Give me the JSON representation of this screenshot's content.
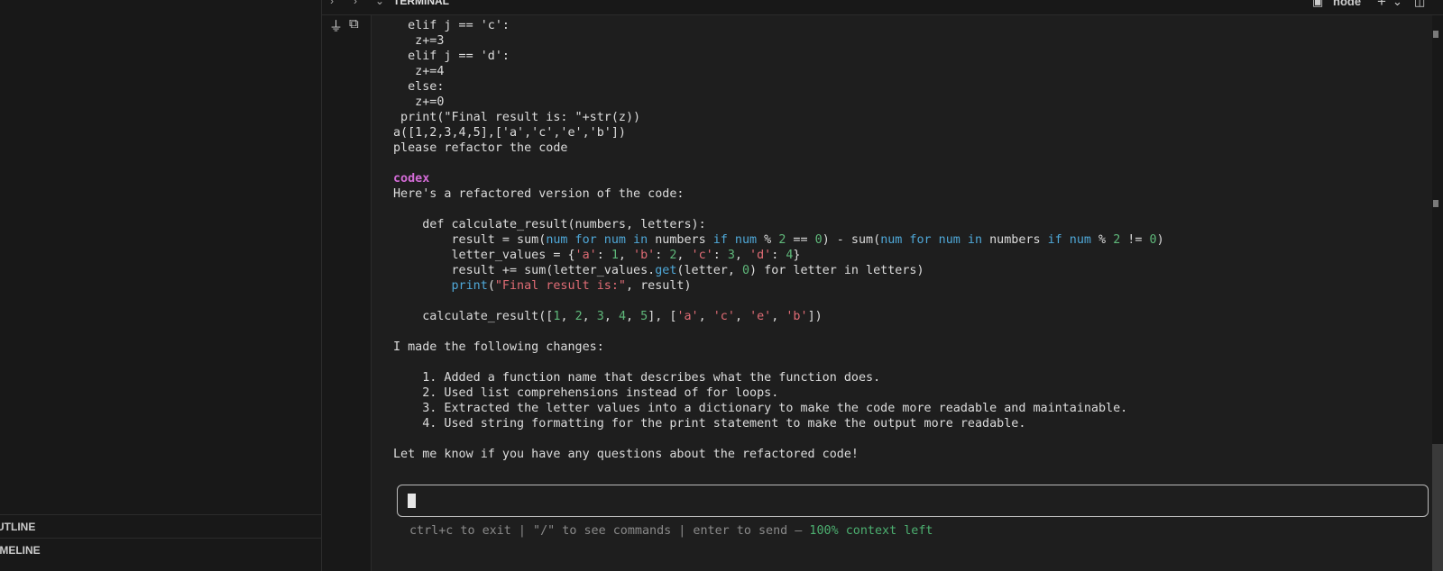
{
  "sidebar": {
    "outline": "UTLINE",
    "timeline": "IMELINE"
  },
  "panel": {
    "tab_label": "TERMINAL",
    "shell_name": "node"
  },
  "terminal_lines": {
    "l0": "  elif j == 'c':",
    "l1": "   z+=3",
    "l2": "  elif j == 'd':",
    "l3": "   z+=4",
    "l4": "  else:",
    "l5": "   z+=0",
    "l6": " print(\"Final result is: \"+str(z))",
    "l7": "a([1,2,3,4,5],['a','c','e','b'])",
    "l8": "please refactor the code",
    "codex": "codex",
    "intro": "Here's a refactored version of the code:",
    "def_line": "    def calculate_result(numbers, letters):",
    "code2": {
      "a": "        result = sum(",
      "b": "num for num in",
      "c": " numbers ",
      "d": "if num",
      "e": " % ",
      "f": "2",
      "g": " == ",
      "h": "0",
      "i": ") - sum(",
      "j": "num for num in",
      "k": " numbers ",
      "l": "if num",
      "m": " % ",
      "n": "2",
      "o": " != ",
      "p": "0",
      "q": ")"
    },
    "code3": {
      "a": "        letter_values = {",
      "b": "'a'",
      "c": ": ",
      "d": "1",
      "e": ", ",
      "f": "'b'",
      "g": ": ",
      "h": "2",
      "i": ", ",
      "j": "'c'",
      "k": ": ",
      "l": "3",
      "m": ", ",
      "n": "'d'",
      "o": ": ",
      "p": "4",
      "q": "}"
    },
    "code4": {
      "a": "        result += sum(letter_values.",
      "b": "get",
      "c": "(letter, ",
      "d": "0",
      "e": ") for letter in letters)"
    },
    "code5": {
      "a": "        ",
      "b": "print",
      "c": "(",
      "d": "\"Final result is:\"",
      "e": ", result)"
    },
    "call": {
      "a": "    calculate_result([",
      "b": "1",
      "c": ", ",
      "d": "2",
      "e": ", ",
      "f": "3",
      "g": ", ",
      "h": "4",
      "i": ", ",
      "j": "5",
      "k": "], [",
      "l": "'a'",
      "m": ", ",
      "n": "'c'",
      "o": ", ",
      "p": "'e'",
      "q": ", ",
      "r": "'b'",
      "s": "])"
    },
    "changes_intro": "I made the following changes:",
    "c1": "    1. Added a function name that describes what the function does.",
    "c2": "    2. Used list comprehensions instead of for loops.",
    "c3": "    3. Extracted the letter values into a dictionary to make the code more readable and maintainable.",
    "c4": "    4. Used string formatting for the print statement to make the output more readable.",
    "closing": "Let me know if you have any questions about the refactored code!"
  },
  "footer": {
    "hint": "ctrl+c to exit | \"/\" to see commands | enter to send — ",
    "context": "100% context left"
  },
  "icons": {
    "chevron_left": "chevron-right-icon",
    "chevron_down": "chevron-down-icon",
    "plug": "plug-icon",
    "terminal": "terminal-icon",
    "add": "add-icon",
    "split": "split-icon"
  }
}
